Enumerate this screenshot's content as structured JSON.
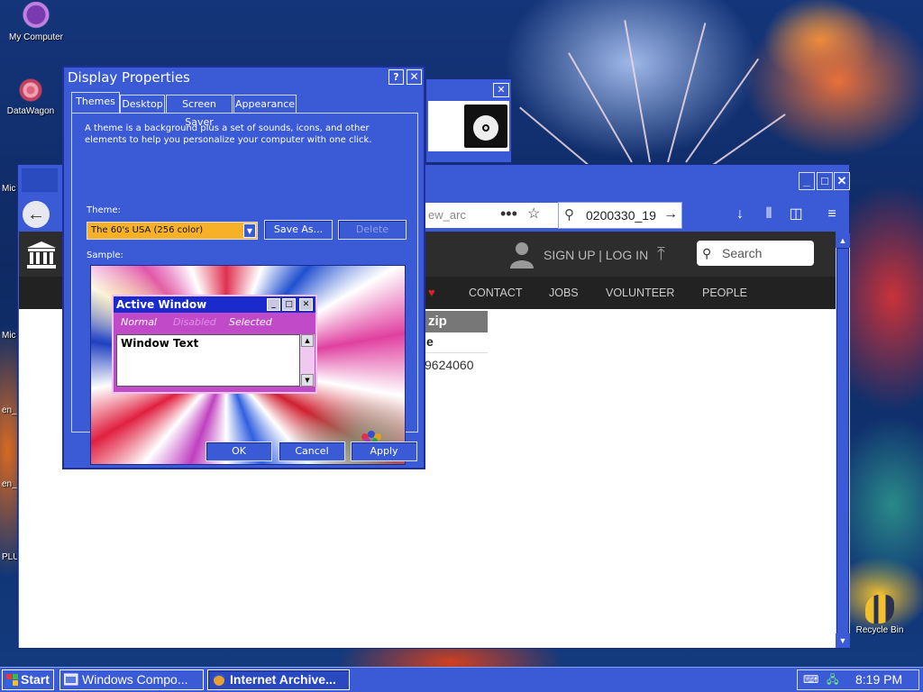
{
  "desktop": {
    "icons": [
      {
        "label": "My Computer",
        "icon": "my-computer-icon"
      },
      {
        "label": "DataWagon",
        "icon": "datawagon-icon"
      },
      {
        "label": "Recycle Bin",
        "icon": "recycle-bin-icon"
      }
    ],
    "edge_labels": [
      "Mic",
      "Mic",
      "en_",
      "en_",
      "PLU"
    ]
  },
  "display_properties": {
    "title": "Display Properties",
    "help_button": "?",
    "close_button": "✕",
    "tabs": [
      "Themes",
      "Desktop",
      "Screen Saver",
      "Appearance"
    ],
    "active_tab": "Themes",
    "description": "A theme is a background plus a set of sounds, icons, and other elements to help you personalize your computer with one click.",
    "theme_label": "Theme:",
    "theme_value": "The 60's USA (256 color)",
    "save_as_label": "Save As...",
    "delete_label": "Delete",
    "sample_label": "Sample:",
    "sample_window": {
      "title": "Active Window",
      "menu_normal": "Normal",
      "menu_disabled": "Disabled",
      "menu_selected": "Selected",
      "window_text": "Window Text"
    },
    "ok_label": "OK",
    "cancel_label": "Cancel",
    "apply_label": "Apply"
  },
  "background_window": {
    "close_button": "✕",
    "icon": "cd-package-icon"
  },
  "browser": {
    "url_fragment": "ew_arc",
    "search_text": "0200330_19",
    "header": {
      "signup_text": "SIGN UP | LOG IN",
      "search_placeholder": "Search"
    },
    "menu_items": [
      "CONTACT",
      "JOBS",
      "VOLUNTEER",
      "PEOPLE"
    ],
    "content": {
      "zip_heading": "zip",
      "sub_heading": "e",
      "number": "9624060"
    }
  },
  "taskbar": {
    "start_label": "Start",
    "tasks": [
      {
        "label": "Windows Compo...",
        "icon": "windows-components-icon",
        "active": false
      },
      {
        "label": "Internet Archive...",
        "icon": "internet-archive-icon",
        "active": true
      }
    ],
    "clock": "8:19 PM"
  },
  "colors": {
    "window_blue": "#3a5ad6",
    "theme_select_highlight": "#f6b128",
    "sample_window_pink": "#c04ac8"
  }
}
